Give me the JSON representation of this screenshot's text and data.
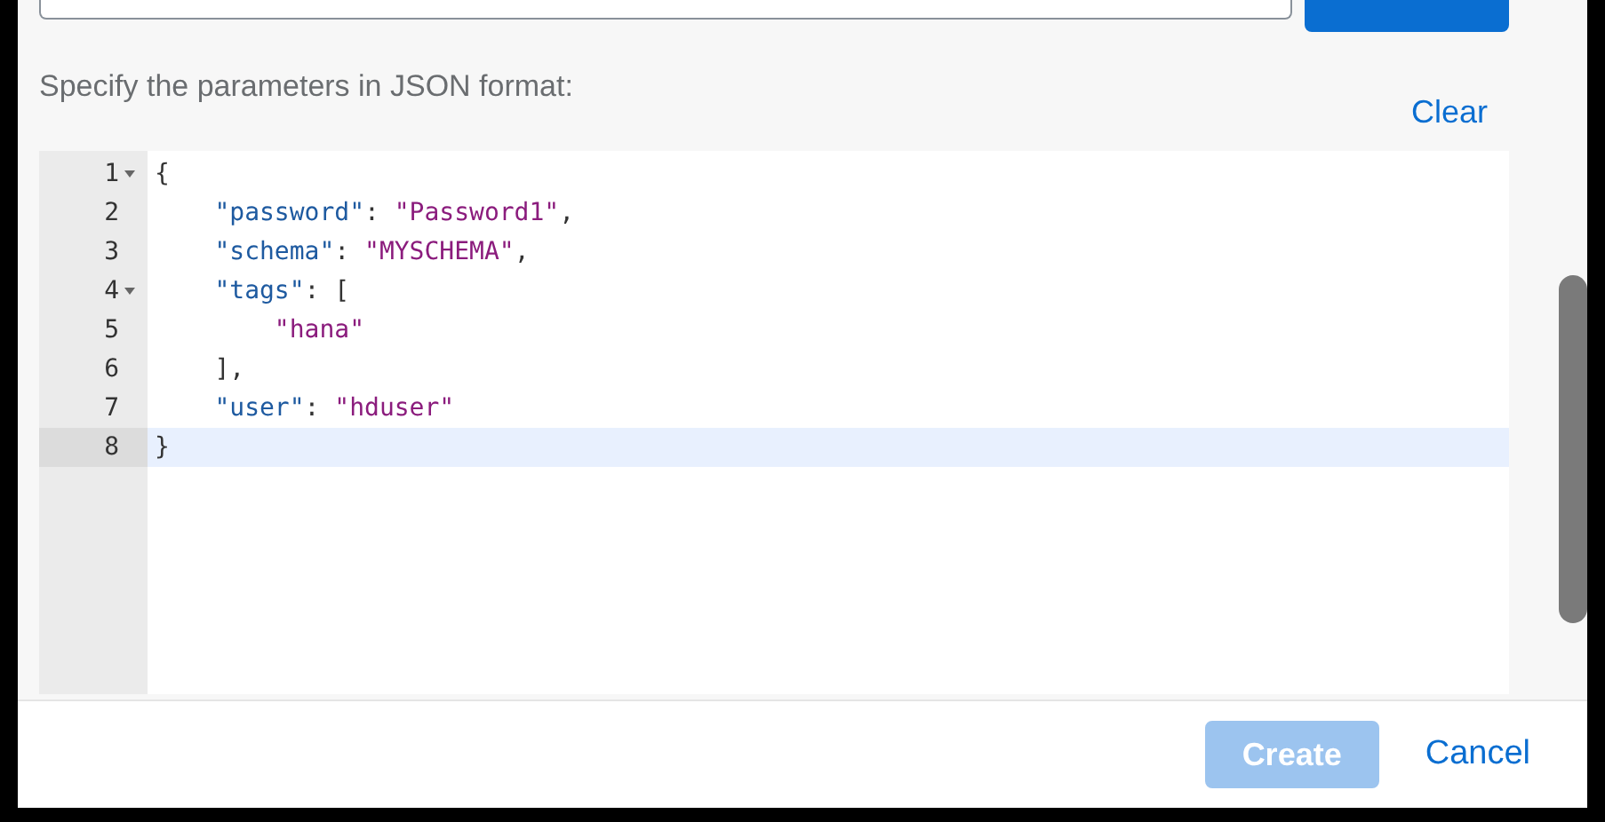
{
  "prompt": "Specify the parameters in JSON format:",
  "clear_link": "Clear",
  "editor": {
    "lines": [
      {
        "number": "1",
        "fold": true,
        "active": false,
        "tokens": [
          {
            "kind": "punct",
            "text": "{"
          }
        ]
      },
      {
        "number": "2",
        "fold": false,
        "active": false,
        "tokens": [
          {
            "kind": "key",
            "text": "    \"password\""
          },
          {
            "kind": "punct",
            "text": ": "
          },
          {
            "kind": "string",
            "text": "\"Password1\""
          },
          {
            "kind": "punct",
            "text": ","
          }
        ]
      },
      {
        "number": "3",
        "fold": false,
        "active": false,
        "tokens": [
          {
            "kind": "key",
            "text": "    \"schema\""
          },
          {
            "kind": "punct",
            "text": ": "
          },
          {
            "kind": "string",
            "text": "\"MYSCHEMA\""
          },
          {
            "kind": "punct",
            "text": ","
          }
        ]
      },
      {
        "number": "4",
        "fold": true,
        "active": false,
        "tokens": [
          {
            "kind": "key",
            "text": "    \"tags\""
          },
          {
            "kind": "punct",
            "text": ": ["
          }
        ]
      },
      {
        "number": "5",
        "fold": false,
        "active": false,
        "tokens": [
          {
            "kind": "string",
            "text": "        \"hana\""
          }
        ]
      },
      {
        "number": "6",
        "fold": false,
        "active": false,
        "tokens": [
          {
            "kind": "punct",
            "text": "    ],"
          }
        ]
      },
      {
        "number": "7",
        "fold": false,
        "active": false,
        "tokens": [
          {
            "kind": "key",
            "text": "    \"user\""
          },
          {
            "kind": "punct",
            "text": ": "
          },
          {
            "kind": "string",
            "text": "\"hduser\""
          }
        ]
      },
      {
        "number": "8",
        "fold": false,
        "active": true,
        "tokens": [
          {
            "kind": "punct",
            "text": "}"
          }
        ]
      }
    ]
  },
  "footer": {
    "buttons": [
      {
        "kind": "primary",
        "label": "Create",
        "disabled": true
      },
      {
        "kind": "link",
        "label": "Cancel",
        "disabled": false
      }
    ]
  }
}
